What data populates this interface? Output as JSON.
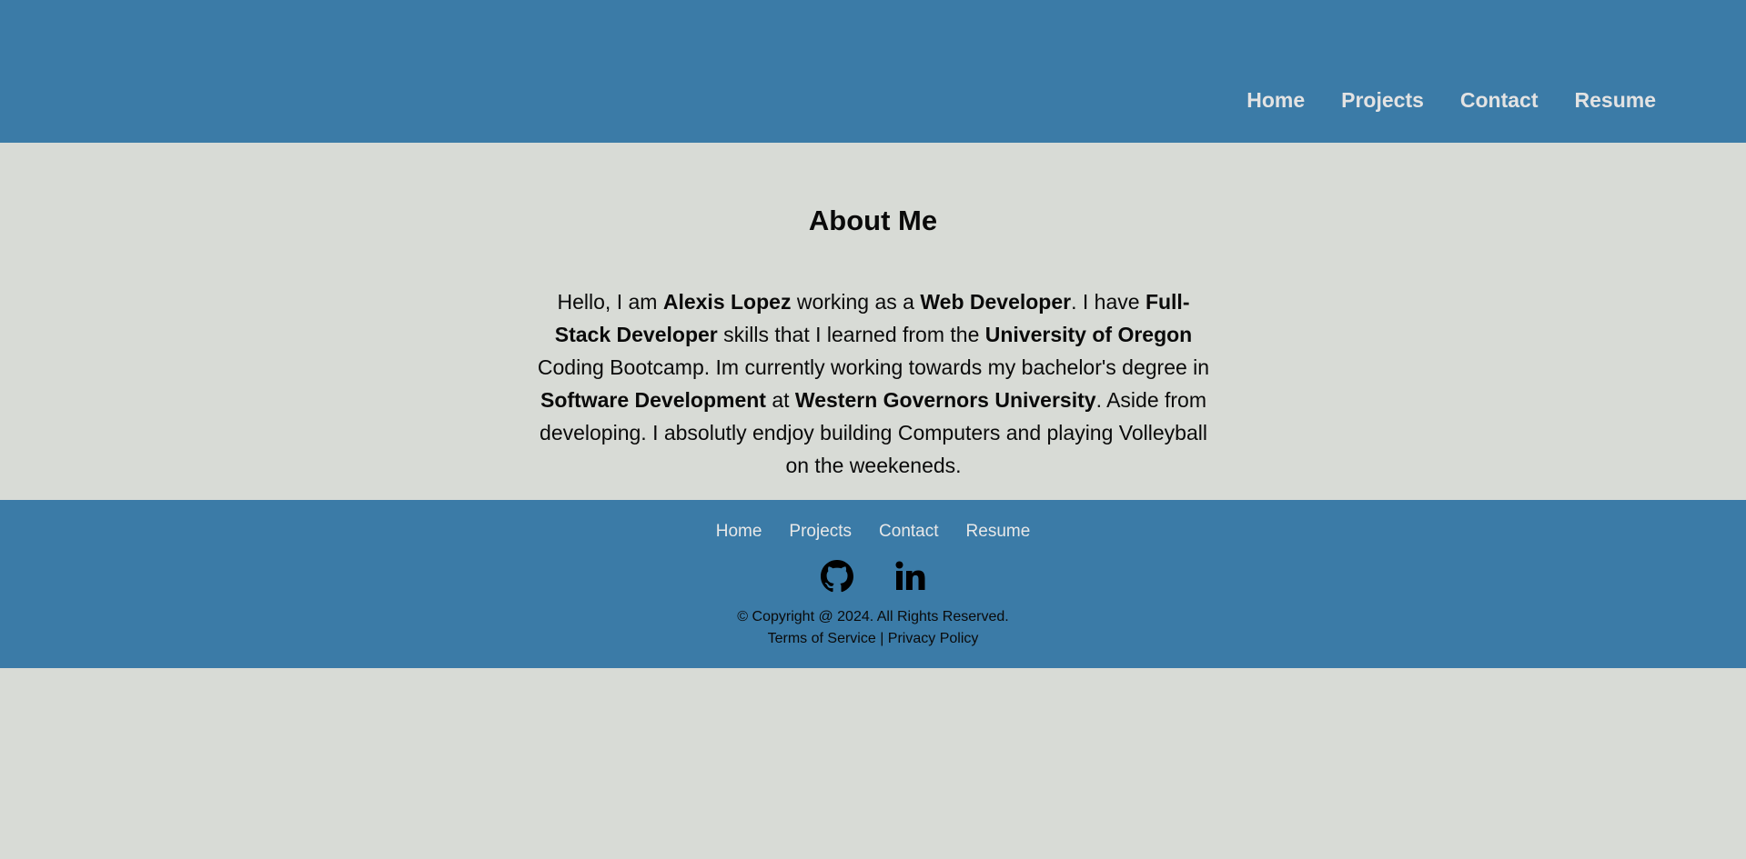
{
  "nav": {
    "items": [
      "Home",
      "Projects",
      "Contact",
      "Resume"
    ]
  },
  "about": {
    "title": "About Me",
    "parts": [
      "Hello, I am ",
      "Alexis Lopez",
      " working as a ",
      "Web Developer",
      ". I have ",
      "Full-Stack Developer",
      " skills that I learned from the ",
      "University of Oregon",
      " Coding Bootcamp. Im currently working towards my bachelor's degree in ",
      "Software Development",
      " at ",
      "Western Governors University",
      ". Aside from developing. I absolutly endjoy building Computers and playing Volleyball on the weekeneds."
    ]
  },
  "footer": {
    "nav": [
      "Home",
      "Projects",
      "Contact",
      "Resume"
    ],
    "social": [
      "github-icon",
      "linkedin-icon"
    ],
    "copyright": "© Copyright @ 2024. All Rights Reserved.",
    "terms": "Terms of Service",
    "separator": " | ",
    "privacy": "Privacy Policy"
  },
  "colors": {
    "header_bg": "#3b7ba7",
    "page_bg": "#d8dbd6",
    "nav_text": "#e3e3e3"
  }
}
